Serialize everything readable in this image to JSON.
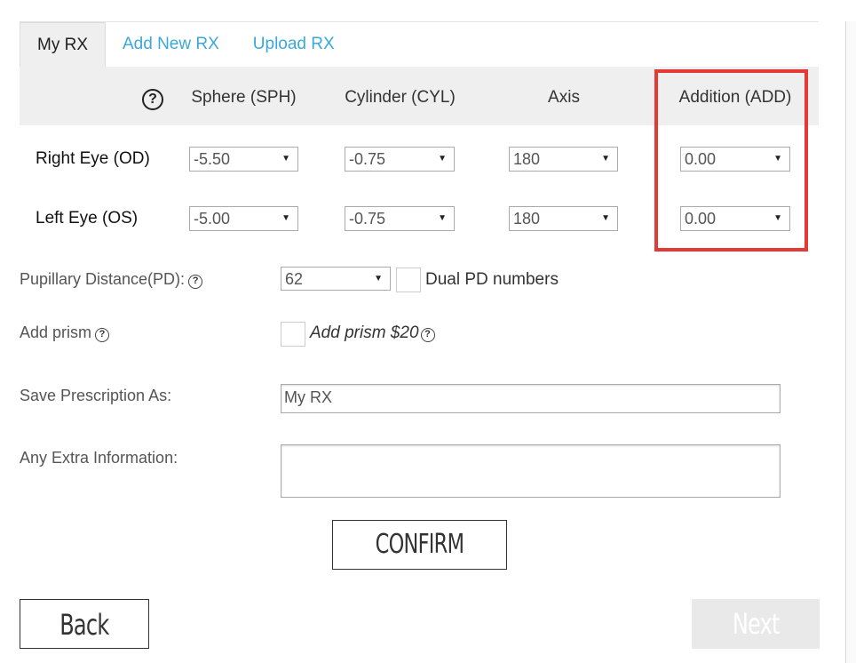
{
  "tabs": [
    {
      "label": "My RX",
      "active": true
    },
    {
      "label": "Add New RX",
      "active": false
    },
    {
      "label": "Upload RX",
      "active": false
    }
  ],
  "table": {
    "help_icon": "?",
    "columns": [
      "Sphere (SPH)",
      "Cylinder (CYL)",
      "Axis",
      "Addition (ADD)"
    ],
    "rows": [
      {
        "eye": "Right Eye (OD)",
        "sph": "-5.50",
        "cyl": "-0.75",
        "axis": "180",
        "add": "0.00"
      },
      {
        "eye": "Left Eye (OS)",
        "sph": "-5.00",
        "cyl": "-0.75",
        "axis": "180",
        "add": "0.00"
      }
    ]
  },
  "highlight_color": "#e53935",
  "pd": {
    "label": "Pupillary Distance(PD):",
    "help_icon": "?",
    "value": "62",
    "dual_label": "Dual PD numbers"
  },
  "prism": {
    "label": "Add prism",
    "help_icon": "?",
    "checkbox_label": "Add prism $20"
  },
  "save": {
    "label": "Save Prescription As:",
    "value": "My RX"
  },
  "extra": {
    "label": "Any Extra Information:",
    "value": ""
  },
  "buttons": {
    "confirm": "CONFIRM",
    "back": "Back",
    "next": "Next"
  },
  "colors": {
    "link": "#3aa8d8",
    "header_bg": "#efefef",
    "next_bg": "#e9e9e9"
  }
}
